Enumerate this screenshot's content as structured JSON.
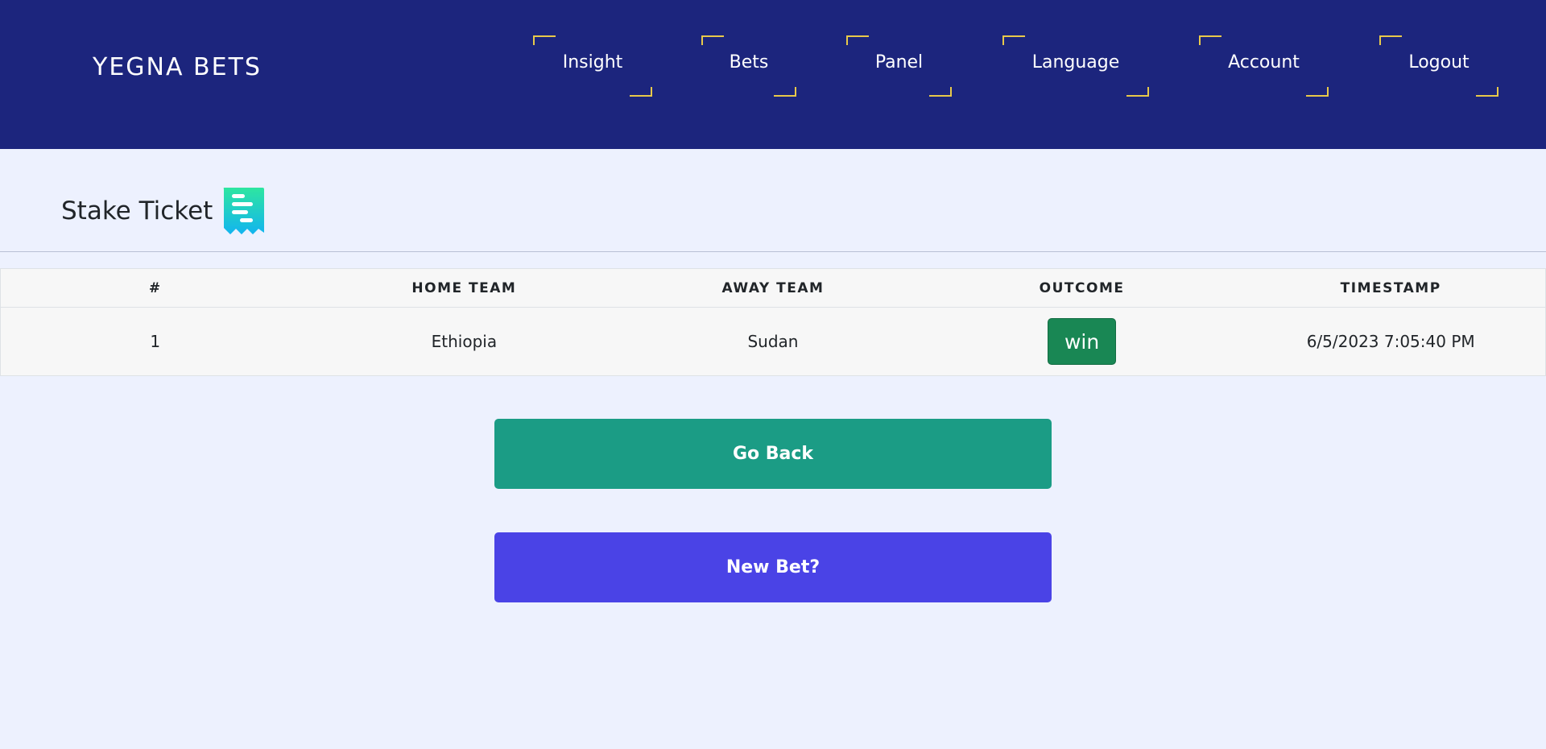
{
  "header": {
    "brand": "YEGNA BETS",
    "nav": [
      {
        "label": "Insight"
      },
      {
        "label": "Bets"
      },
      {
        "label": "Panel"
      },
      {
        "label": "Language"
      },
      {
        "label": "Account"
      },
      {
        "label": "Logout"
      }
    ]
  },
  "page": {
    "title": "Stake Ticket",
    "title_icon": "receipt-icon"
  },
  "table": {
    "columns": [
      "#",
      "HOME TEAM",
      "AWAY TEAM",
      "OUTCOME",
      "TIMESTAMP"
    ],
    "rows": [
      {
        "index": "1",
        "home_team": "Ethiopia",
        "away_team": "Sudan",
        "outcome": "win",
        "timestamp": "6/5/2023 7:05:40 PM"
      }
    ]
  },
  "actions": {
    "go_back_label": "Go Back",
    "new_bet_label": "New Bet?"
  },
  "colors": {
    "header_bg": "#1c257d",
    "nav_accent": "#e8c94a",
    "page_bg": "#edf1fe",
    "outcome_win": "#198754",
    "go_back_bg": "#1b9c85",
    "new_bet_bg": "#4a43e6"
  }
}
